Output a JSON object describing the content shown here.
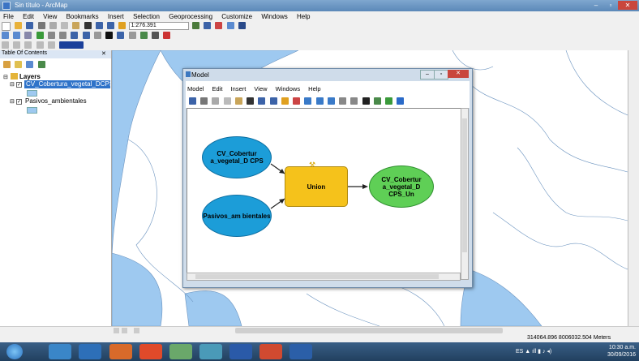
{
  "window": {
    "title": "Sin título - ArcMap"
  },
  "menu": [
    "File",
    "Edit",
    "View",
    "Bookmarks",
    "Insert",
    "Selection",
    "Geoprocessing",
    "Customize",
    "Windows",
    "Help"
  ],
  "toolbar": {
    "scale_value": "1:276.391"
  },
  "toc": {
    "title": "Table Of Contents",
    "root": "Layers",
    "layers": [
      {
        "label": "CV_Cobertura_vegetal_DCPS",
        "checked": true,
        "selected": true,
        "swatch": "#9ec9f0"
      },
      {
        "label": "Pasivos_ambientales",
        "checked": true,
        "selected": false,
        "swatch": "#9ec9f0"
      }
    ]
  },
  "model": {
    "title": "Model",
    "menu": [
      "Model",
      "Edit",
      "Insert",
      "View",
      "Windows",
      "Help"
    ],
    "nodes": {
      "input1": "CV_Cobertur a_vegetal_D CPS",
      "input2": "Pasivos_am bientales",
      "tool": "Union",
      "output": "CV_Cobertur a_vegetal_D CPS_Un"
    },
    "colors": {
      "input": "#1c9dd8",
      "tool": "#f5c21b",
      "output": "#5fcf56"
    }
  },
  "status": {
    "coordinates": "314064.896 8006032.504 Meters"
  },
  "taskbar": {
    "clock_time": "10:30 a.m.",
    "clock_date": "30/09/2016"
  },
  "colors": {
    "water": "#9ec9f0",
    "titlebar": "#5b88b8"
  }
}
